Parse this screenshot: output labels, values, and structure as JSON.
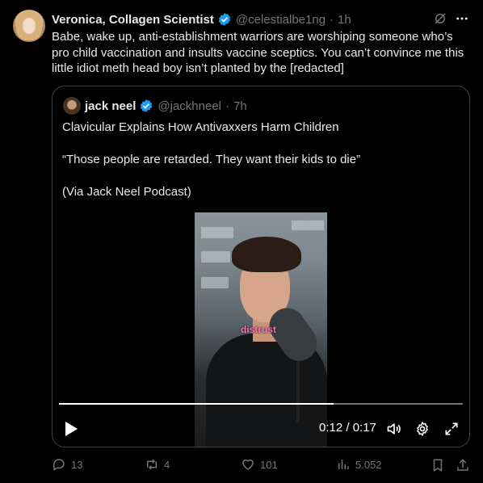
{
  "tweet": {
    "author_name": "Veronica, Collagen Scientist",
    "handle": "@celestialbe1ng",
    "time": "1h",
    "text": "Babe, wake up, anti-establishment warriors are worshiping someone who’s pro child vaccination and insults vaccine sceptics. You can’t convince me this little idiot meth head boy isn’t planted by the [redacted]"
  },
  "quote": {
    "author_name": "jack neel",
    "handle": "@jackhneel",
    "time": "7h",
    "line1": "Clavicular Explains How Antivaxxers Harm Children",
    "line2": "“Those people are retarded. They want their kids to die”",
    "line3": "(Via Jack Neel Podcast)",
    "video": {
      "caption": "distrust",
      "time_display": "0:12 / 0:17",
      "progress": 0.68
    }
  },
  "actions": {
    "replies": "13",
    "reposts": "4",
    "likes": "101",
    "views": "5.052"
  },
  "colors": {
    "accent": "#1d9bf0",
    "muted": "#71767b",
    "text": "#e7e9ea"
  }
}
